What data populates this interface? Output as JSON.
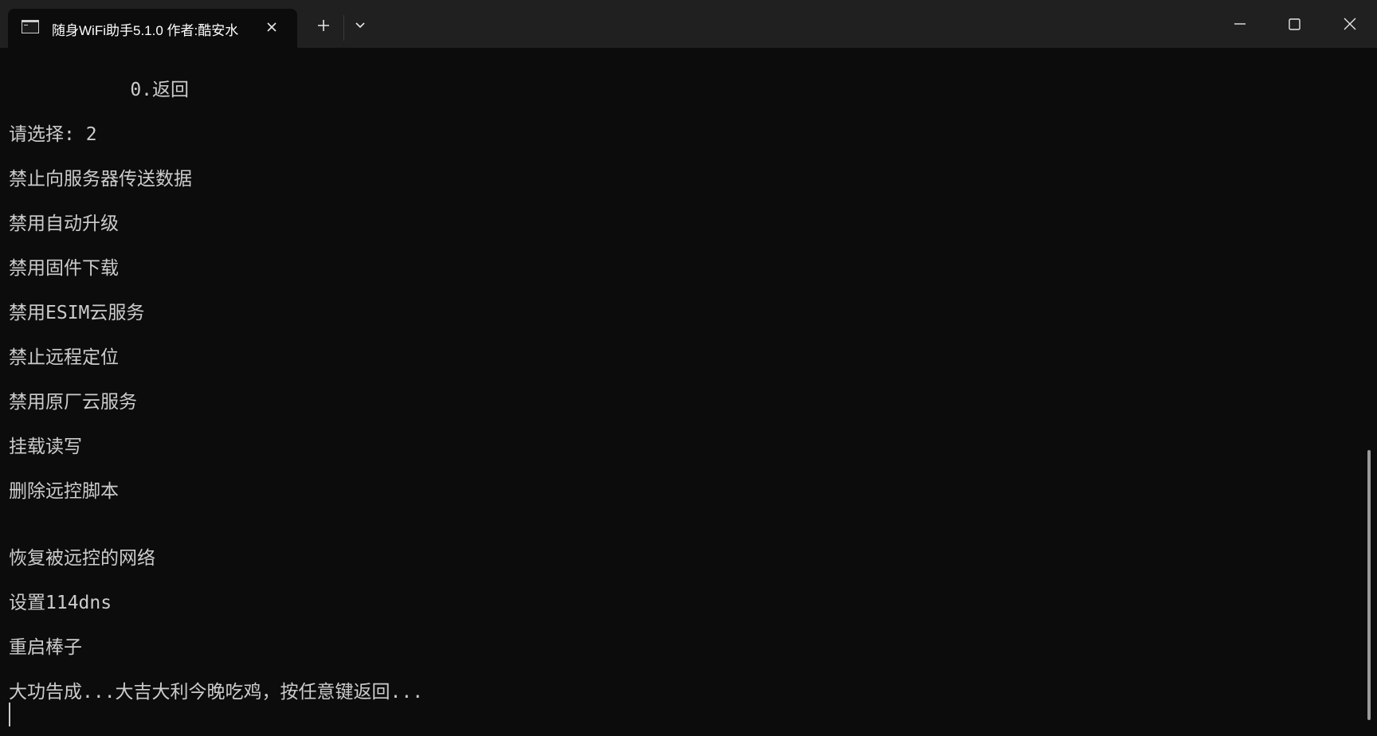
{
  "tab": {
    "title": "随身WiFi助手5.1.0 作者:酷安水",
    "icon": "terminal-icon"
  },
  "titlebar_buttons": {
    "new_tab_icon": "plus-icon",
    "dropdown_icon": "chevron-down-icon",
    "close_tab_icon": "close-icon"
  },
  "window_controls": {
    "minimize_icon": "minimize-icon",
    "maximize_icon": "maximize-icon",
    "close_icon": "close-icon"
  },
  "console": {
    "lines": [
      "           0.返回",
      "请选择: 2",
      "禁止向服务器传送数据",
      "禁用自动升级",
      "禁用固件下载",
      "禁用ESIM云服务",
      "禁止远程定位",
      "禁用原厂云服务",
      "挂载读写",
      "删除远控脚本",
      "恢复被远控的网络",
      "设置114dns",
      "重启棒子",
      "大功告成...大吉大利今晚吃鸡，按任意键返回..."
    ]
  },
  "colors": {
    "background": "#0c0c0c",
    "titlebar": "#202020",
    "text": "#cccccc"
  }
}
